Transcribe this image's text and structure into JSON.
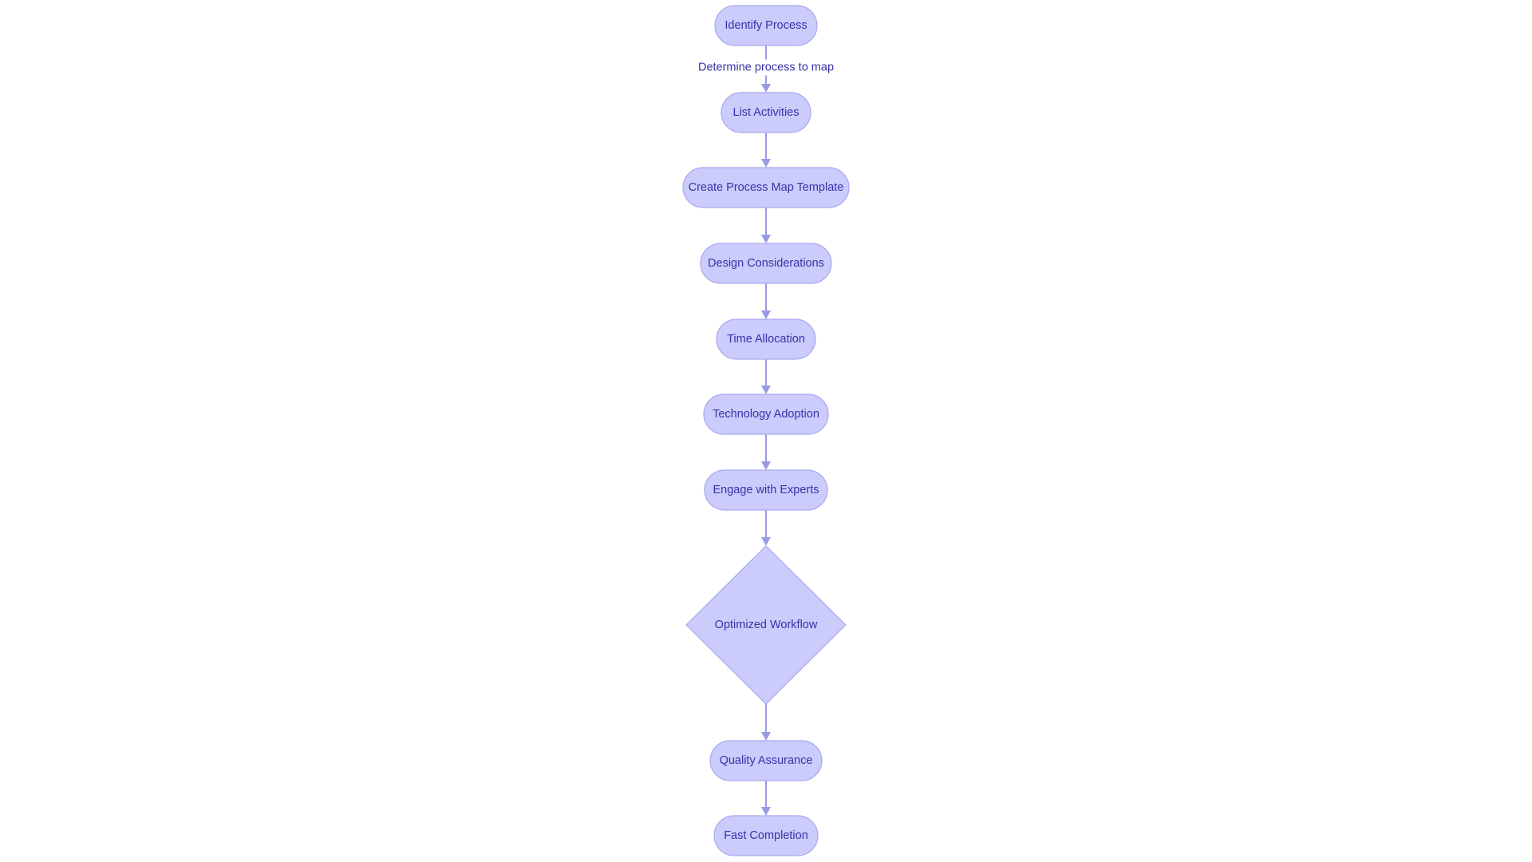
{
  "diagram": {
    "type": "flowchart",
    "direction": "top-to-bottom",
    "colors": {
      "node_fill": "#cbcbfc",
      "node_stroke": "#a9a9f0",
      "text": "#3434a8",
      "edge": "#9a9ae4"
    },
    "nodes": [
      {
        "id": "identify",
        "label": "Identify Process",
        "shape": "rounded"
      },
      {
        "id": "list",
        "label": "List Activities",
        "shape": "rounded"
      },
      {
        "id": "template",
        "label": "Create Process Map Template",
        "shape": "rounded"
      },
      {
        "id": "design",
        "label": "Design Considerations",
        "shape": "rounded"
      },
      {
        "id": "time",
        "label": "Time Allocation",
        "shape": "rounded"
      },
      {
        "id": "tech",
        "label": "Technology Adoption",
        "shape": "rounded"
      },
      {
        "id": "experts",
        "label": "Engage with Experts",
        "shape": "rounded"
      },
      {
        "id": "workflow",
        "label": "Optimized Workflow",
        "shape": "diamond"
      },
      {
        "id": "qa",
        "label": "Quality Assurance",
        "shape": "rounded"
      },
      {
        "id": "fast",
        "label": "Fast Completion",
        "shape": "rounded"
      }
    ],
    "edges": [
      {
        "from": "identify",
        "to": "list",
        "label": "Determine process to map"
      },
      {
        "from": "list",
        "to": "template",
        "label": ""
      },
      {
        "from": "template",
        "to": "design",
        "label": ""
      },
      {
        "from": "design",
        "to": "time",
        "label": ""
      },
      {
        "from": "time",
        "to": "tech",
        "label": ""
      },
      {
        "from": "tech",
        "to": "experts",
        "label": ""
      },
      {
        "from": "experts",
        "to": "workflow",
        "label": ""
      },
      {
        "from": "workflow",
        "to": "qa",
        "label": ""
      },
      {
        "from": "qa",
        "to": "fast",
        "label": ""
      }
    ]
  }
}
